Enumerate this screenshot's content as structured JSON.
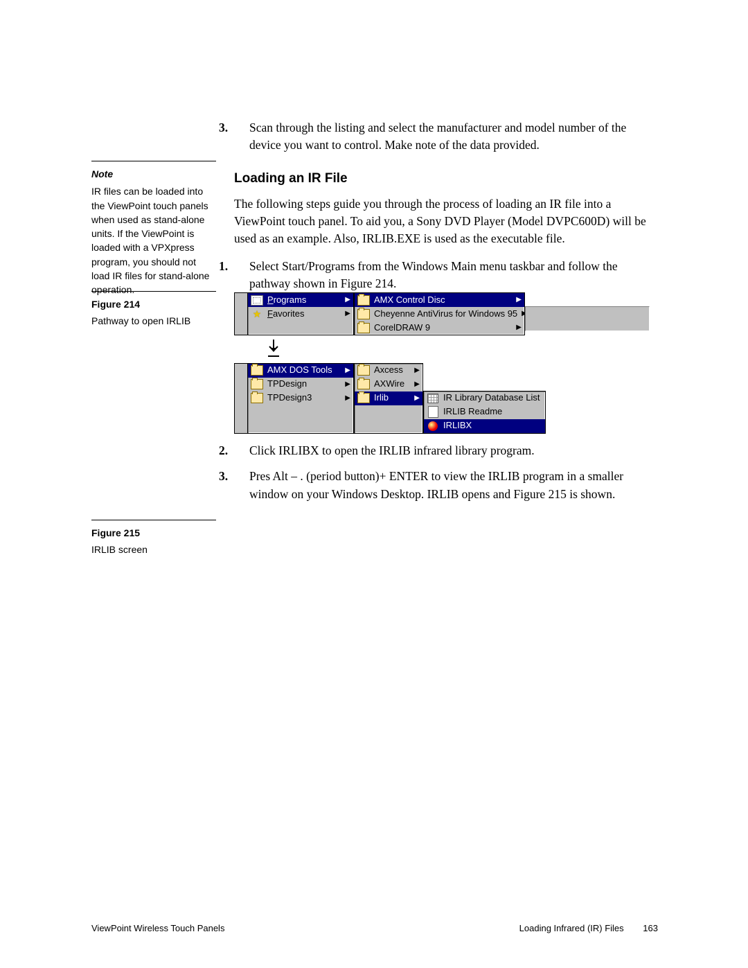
{
  "main": {
    "step3": {
      "num": "3.",
      "text": "Scan through the listing and select the manufacturer and model number of the device you want to control. Make note of the data provided."
    },
    "h2": "Loading an IR File",
    "intro": "The following steps guide you through the process of loading an IR file into a ViewPoint touch panel. To aid you, a Sony DVD Player (Model DVPC600D) will be used as an example. Also, IRLIB.EXE is used as the executable file.",
    "l1": {
      "num": "1.",
      "text": "Select Start/Programs from the Windows Main menu taskbar and follow the pathway shown in Figure 214."
    },
    "l2": {
      "num": "2.",
      "text": "Click IRLIBX to open the IRLIB infrared library program."
    },
    "l3": {
      "num": "3.",
      "text": "Pres Alt – . (period button)+ ENTER to view the IRLIB program in a smaller window on your Windows Desktop. IRLIB opens and Figure 215 is shown."
    }
  },
  "side": {
    "note_title": "Note",
    "note_body": "IR files can be loaded into the ViewPoint touch panels when used as stand-alone units. If the ViewPoint is loaded with a VPXpress program, you should not load IR files for stand-alone operation.",
    "fig214_label": "Figure 214",
    "fig214_cap": "Pathway to open IRLIB",
    "fig215_label": "Figure 215",
    "fig215_cap": "IRLIB screen"
  },
  "menus": {
    "col1a": [
      {
        "pre": "P",
        "label": "rograms",
        "hi": true,
        "arrow": true,
        "icon": "prog"
      },
      {
        "pre": "F",
        "label": "avorites",
        "hi": false,
        "arrow": true,
        "icon": "star"
      }
    ],
    "col2a": [
      {
        "label": "AMX Control Disc",
        "hi": true,
        "arrow": true,
        "icon": "folder"
      },
      {
        "label": "Cheyenne AntiVirus for Windows 95",
        "hi": false,
        "arrow": true,
        "icon": "folder"
      },
      {
        "label": "CorelDRAW 9",
        "hi": false,
        "arrow": true,
        "icon": "folder"
      }
    ],
    "col1b": [
      {
        "label": "AMX DOS Tools",
        "hi": true,
        "arrow": true,
        "icon": "folder"
      },
      {
        "label": "TPDesign",
        "hi": false,
        "arrow": true,
        "icon": "folder"
      },
      {
        "label": "TPDesign3",
        "hi": false,
        "arrow": true,
        "icon": "folder"
      }
    ],
    "col2b": [
      {
        "label": "Axcess",
        "hi": false,
        "arrow": true,
        "icon": "folder"
      },
      {
        "label": "AXWire",
        "hi": false,
        "arrow": true,
        "icon": "folder"
      },
      {
        "label": "Irlib",
        "hi": true,
        "arrow": true,
        "icon": "folder"
      }
    ],
    "col3b": [
      {
        "label": "IR Library Database List",
        "hi": false,
        "arrow": false,
        "icon": "grid"
      },
      {
        "label": "IRLIB Readme",
        "hi": false,
        "arrow": false,
        "icon": "doc"
      },
      {
        "label": "IRLIBX",
        "hi": true,
        "arrow": false,
        "icon": "red"
      }
    ]
  },
  "footer": {
    "left": "ViewPoint Wireless Touch Panels",
    "right": "Loading Infrared (IR) Files",
    "page": "163"
  }
}
